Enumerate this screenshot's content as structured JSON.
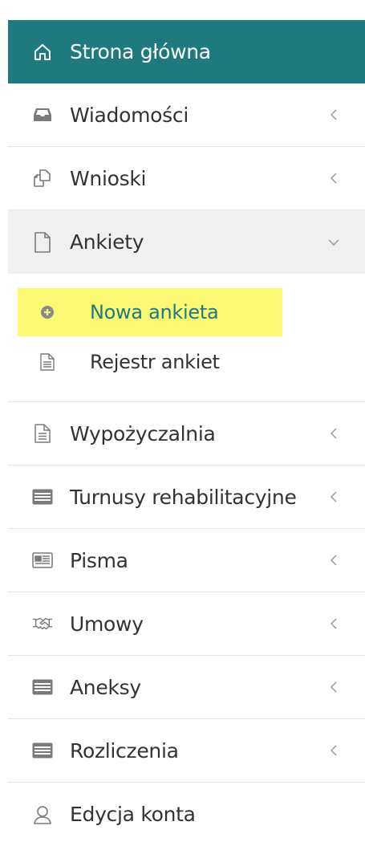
{
  "menu": {
    "home": {
      "label": "Strona główna",
      "icon": "home-icon"
    },
    "messages": {
      "label": "Wiadomości",
      "icon": "inbox-icon"
    },
    "requests": {
      "label": "Wnioski",
      "icon": "copy-icon"
    },
    "surveys": {
      "label": "Ankiety",
      "icon": "file-icon",
      "children": [
        {
          "label": "Nowa ankieta",
          "icon": "plus-circle-icon"
        },
        {
          "label": "Rejestr ankiet",
          "icon": "file-text-icon"
        }
      ]
    },
    "rental": {
      "label": "Wypożyczalnia",
      "icon": "file-text-icon"
    },
    "rehab": {
      "label": "Turnusy rehabilitacyjne",
      "icon": "list-card-icon"
    },
    "letters": {
      "label": "Pisma",
      "icon": "newspaper-icon"
    },
    "contracts": {
      "label": "Umowy",
      "icon": "handshake-icon"
    },
    "annexes": {
      "label": "Aneksy",
      "icon": "list-card-icon"
    },
    "settlements": {
      "label": "Rozliczenia",
      "icon": "list-card-icon"
    },
    "account": {
      "label": "Edycja konta",
      "icon": "user-icon"
    }
  },
  "colors": {
    "active_bg": "#1f7a80",
    "highlight": "#fbf873",
    "open_bg": "#f0f0f0",
    "icon_gray": "#8a8a8a"
  }
}
